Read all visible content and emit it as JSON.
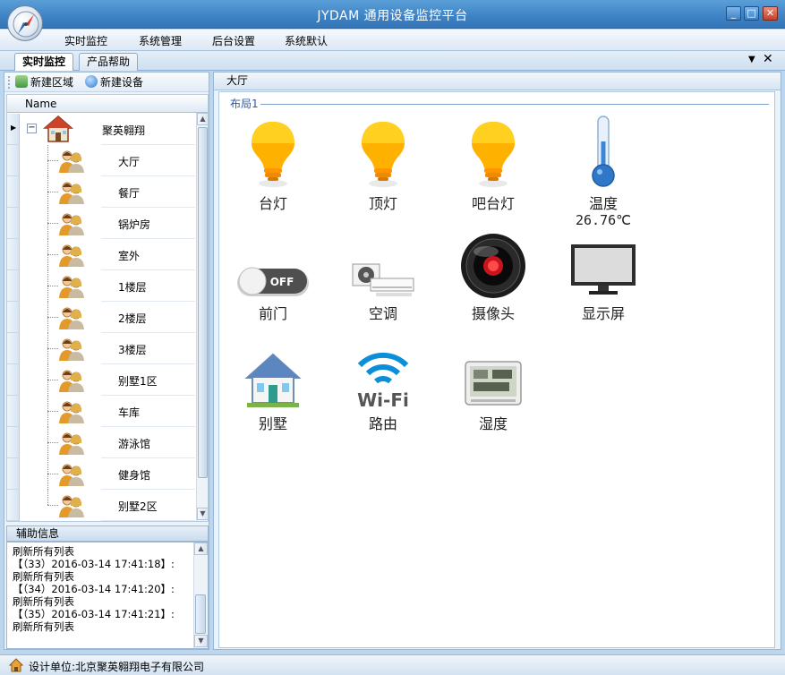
{
  "window": {
    "title": "JYDAM 通用设备监控平台",
    "buttons": {
      "minimize": "_",
      "maximize": "□",
      "close": "✕"
    }
  },
  "menu": [
    "实时监控",
    "系统管理",
    "后台设置",
    "系统默认"
  ],
  "tabs": {
    "active": "实时监控",
    "other": "产品帮助",
    "menu_arrow": "▼",
    "close": "✕"
  },
  "left_toolbar": {
    "new_area": "新建区域",
    "new_device": "新建设备"
  },
  "tree": {
    "column_header": "Name",
    "root": {
      "label": "聚英翱翔",
      "expander": "−"
    },
    "children": [
      "大厅",
      "餐厅",
      "锅炉房",
      "室外",
      "1楼层",
      "2楼层",
      "3楼层",
      "别墅1区",
      "车库",
      "游泳馆",
      "健身馆",
      "别墅2区"
    ]
  },
  "aux": {
    "title": "辅助信息",
    "lines": [
      "刷新所有列表",
      "【（33）2016-03-14 17:41:18】:",
      "刷新所有列表",
      "【（34）2016-03-14 17:41:20】:",
      "刷新所有列表",
      "【（35）2016-03-14 17:41:21】:",
      "刷新所有列表"
    ]
  },
  "right": {
    "header": "大厅",
    "group": "布局1",
    "devices": [
      {
        "label": "台灯",
        "icon": "bulb-icon"
      },
      {
        "label": "顶灯",
        "icon": "bulb-icon"
      },
      {
        "label": "吧台灯",
        "icon": "bulb-icon"
      },
      {
        "label": "温度",
        "icon": "thermometer-icon",
        "value": "26.76℃"
      },
      {
        "label": "前门",
        "icon": "toggle-off-icon",
        "switch_text": "OFF"
      },
      {
        "label": "空调",
        "icon": "air-conditioner-icon"
      },
      {
        "label": "摄像头",
        "icon": "camera-icon"
      },
      {
        "label": "显示屏",
        "icon": "monitor-icon"
      },
      {
        "label": "别墅",
        "icon": "house-icon"
      },
      {
        "label": "路由",
        "icon": "wifi-icon",
        "logo_text": "Wi-Fi"
      },
      {
        "label": "湿度",
        "icon": "hygrometer-icon"
      }
    ]
  },
  "status": {
    "text": "设计单位:北京聚英翱翔电子有限公司"
  },
  "colors": {
    "title_bar": "#3d82c4",
    "bulb": "#ffa800",
    "accent": "#2a58a6"
  }
}
